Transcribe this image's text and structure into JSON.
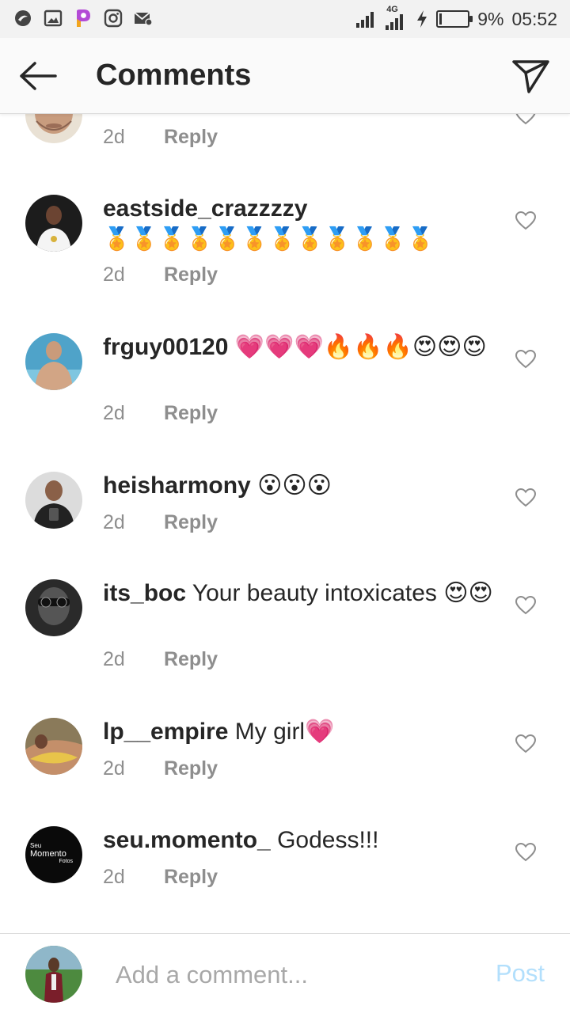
{
  "status_bar": {
    "left_icons": [
      "swift-icon",
      "gallery-icon",
      "picsart-icon",
      "instagram-icon",
      "mail-icon"
    ],
    "network": "4G",
    "battery": "9%",
    "time": "05:52"
  },
  "header": {
    "title": "Comments"
  },
  "comments": [
    {
      "username": "",
      "text": "",
      "time": "2d",
      "reply_label": "Reply"
    },
    {
      "username": "eastside_crazzzzy",
      "text": "🏅🏅🏅🏅🏅🏅🏅🏅🏅🏅🏅🏅",
      "time": "2d",
      "reply_label": "Reply"
    },
    {
      "username": "frguy00120",
      "text": "💗💗💗🔥🔥🔥😍😍😍",
      "time": "2d",
      "reply_label": "Reply"
    },
    {
      "username": "heisharmony",
      "text": "😮😮😮",
      "time": "2d",
      "reply_label": "Reply"
    },
    {
      "username": "its_boc",
      "text": "Your beauty intoxicates 😍😍",
      "time": "2d",
      "reply_label": "Reply"
    },
    {
      "username": "lp__empire",
      "text": "My girl💗",
      "time": "2d",
      "reply_label": "Reply"
    },
    {
      "username": "seu.momento_",
      "text": "Godess!!!",
      "time": "2d",
      "reply_label": "Reply"
    }
  ],
  "seu_momento_logo": {
    "top": "Seu",
    "main": "Momento",
    "bottom": "Fotos"
  },
  "composer": {
    "placeholder": "Add a comment...",
    "post_label": "Post"
  },
  "colors": {
    "post_disabled": "#b2dffc",
    "meta_gray": "#8e8e8e",
    "text": "#262626"
  }
}
